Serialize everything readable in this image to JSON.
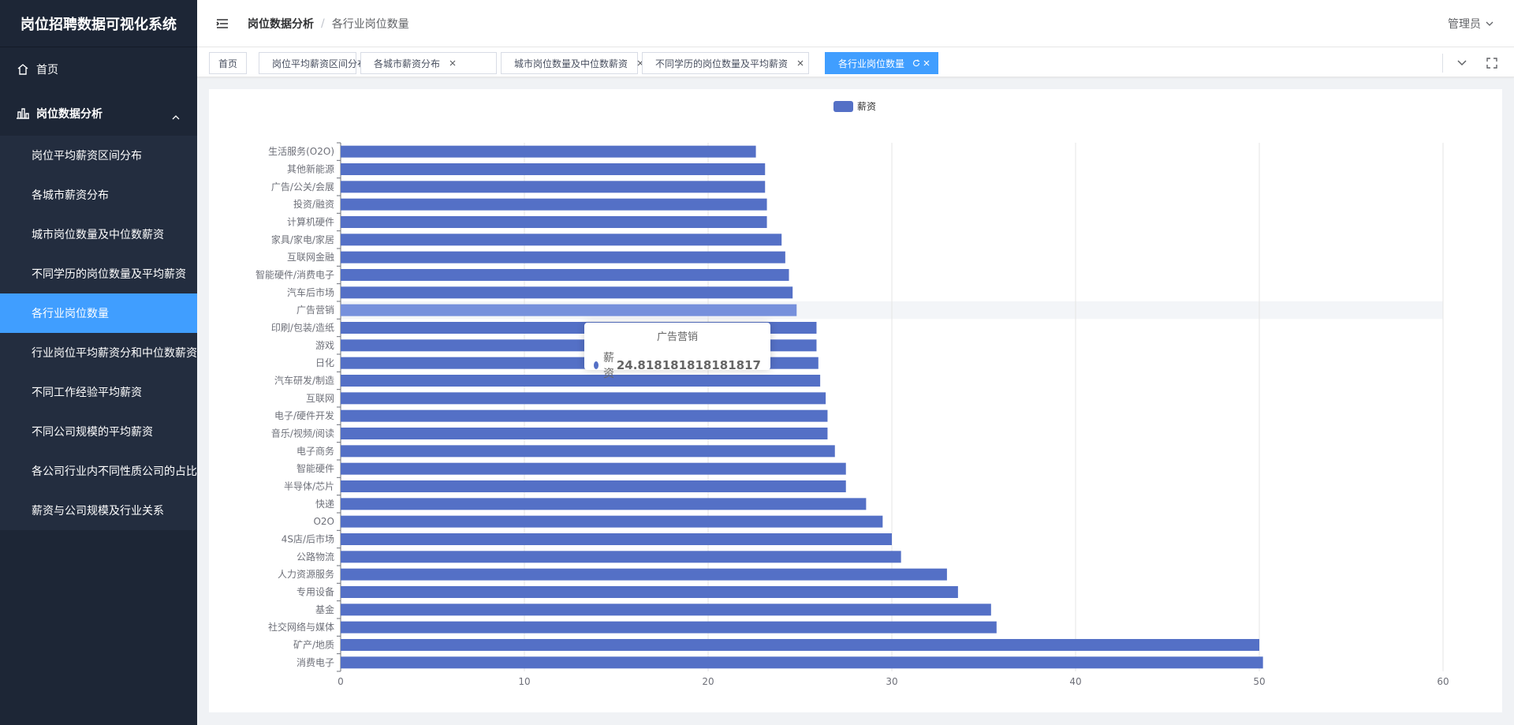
{
  "app": {
    "title": "岗位招聘数据可视化系统"
  },
  "sidebar": {
    "home_label": "首页",
    "group_label": "岗位数据分析",
    "items": [
      {
        "label": "岗位平均薪资区间分布",
        "active": false
      },
      {
        "label": "各城市薪资分布",
        "active": false
      },
      {
        "label": "城市岗位数量及中位数薪资",
        "active": false
      },
      {
        "label": "不同学历的岗位数量及平均薪资",
        "active": false
      },
      {
        "label": "各行业岗位数量",
        "active": true
      },
      {
        "label": "行业岗位平均薪资分和中位数薪资",
        "active": false
      },
      {
        "label": "不同工作经验平均薪资",
        "active": false
      },
      {
        "label": "不同公司规模的平均薪资",
        "active": false
      },
      {
        "label": "各公司行业内不同性质公司的占比",
        "active": false
      },
      {
        "label": "薪资与公司规模及行业关系",
        "active": false
      }
    ]
  },
  "header": {
    "breadcrumb": [
      "岗位数据分析",
      "各行业岗位数量"
    ],
    "user": "管理员"
  },
  "tags": [
    {
      "label": "首页",
      "closable": false,
      "active": false
    },
    {
      "label": "岗位平均薪资区间分布",
      "closable": true,
      "active": false
    },
    {
      "label": "各城市薪资分布",
      "closable": true,
      "active": false
    },
    {
      "label": "城市岗位数量及中位数薪资",
      "closable": true,
      "active": false
    },
    {
      "label": "不同学历的岗位数量及平均薪资",
      "closable": true,
      "active": false
    },
    {
      "label": "各行业岗位数量",
      "closable": true,
      "active": true
    }
  ],
  "colors": {
    "bar": "#5470c6",
    "bar_highlight": "#7690dc",
    "accent": "#409eff",
    "sidebar_bg": "#1d2636"
  },
  "tooltip": {
    "title": "广告营销",
    "series": "薪资",
    "value": "24.818181818181817"
  },
  "chart_data": {
    "type": "bar",
    "orientation": "horizontal",
    "legend": [
      "薪资"
    ],
    "legend_position": "top-center",
    "x_ticks": [
      "0",
      "10",
      "20",
      "30",
      "40",
      "50",
      "60"
    ],
    "xlim": [
      0,
      60
    ],
    "grid": true,
    "categories": [
      "消费电子",
      "矿产/地质",
      "社交网络与媒体",
      "基金",
      "专用设备",
      "人力资源服务",
      "公路物流",
      "4S店/后市场",
      "O2O",
      "快递",
      "半导体/芯片",
      "智能硬件",
      "电子商务",
      "音乐/视频/阅读",
      "电子/硬件开发",
      "互联网",
      "汽车研发/制造",
      "日化",
      "游戏",
      "印刷/包装/造纸",
      "广告营销",
      "汽车后市场",
      "智能硬件/消费电子",
      "互联网金融",
      "家具/家电/家居",
      "计算机硬件",
      "投资/融资",
      "广告/公关/会展",
      "其他新能源",
      "生活服务(O2O)"
    ],
    "series": [
      {
        "name": "薪资",
        "values": [
          50.2,
          50.0,
          35.7,
          35.4,
          33.6,
          33.0,
          30.5,
          30.0,
          29.5,
          28.6,
          27.5,
          27.5,
          26.9,
          26.5,
          26.5,
          26.4,
          26.1,
          26.0,
          25.9,
          25.9,
          24.818181818181817,
          24.6,
          24.4,
          24.2,
          24.0,
          23.2,
          23.2,
          23.1,
          23.1,
          22.6
        ]
      }
    ],
    "highlight_category": "广告营销"
  }
}
